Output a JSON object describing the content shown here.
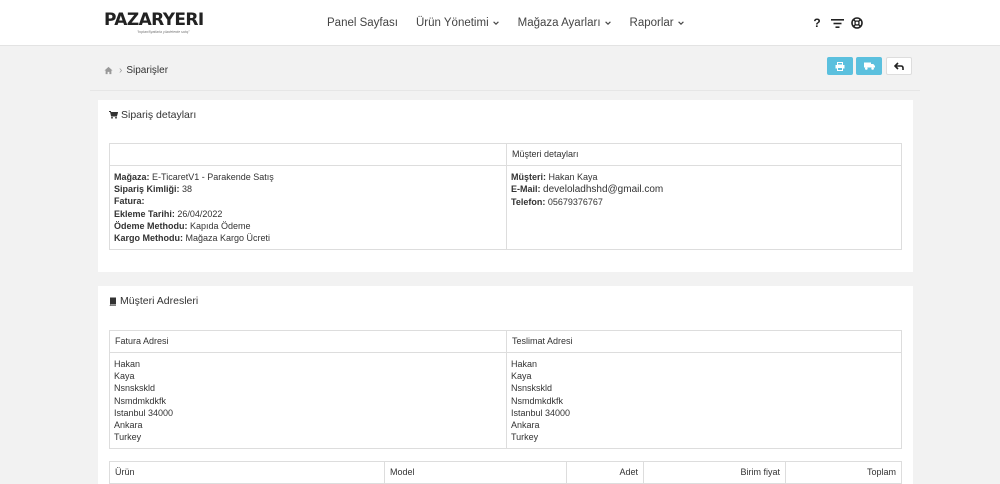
{
  "header": {
    "logo_text": "PAZARYERI",
    "logo_tagline": "\"toptan/fiyatlarla yüzdelerde satış\"",
    "nav": [
      {
        "label": "Panel Sayfası",
        "has_dropdown": false
      },
      {
        "label": "Ürün Yönetimi",
        "has_dropdown": true
      },
      {
        "label": "Mağaza Ayarları",
        "has_dropdown": true
      },
      {
        "label": "Raporlar",
        "has_dropdown": true
      }
    ],
    "icons": [
      "question-icon",
      "filter-icon",
      "support-icon"
    ],
    "question_glyph": "?"
  },
  "breadcrumb": {
    "current": "Siparişler"
  },
  "actions": [
    {
      "icon": "print-icon",
      "color": "#5bc0de"
    },
    {
      "icon": "truck-icon",
      "color": "#5bc0de"
    },
    {
      "icon": "back-icon",
      "color": "#ffffff"
    }
  ],
  "order_panel": {
    "title": "Sipariş detayları",
    "customer_header": "Müşteri detayları",
    "store_fields": [
      {
        "label": "Mağaza:",
        "value": "E-TicaretV1 - Parakende Satış"
      },
      {
        "label": "Sipariş Kimliği:",
        "value": "38"
      },
      {
        "label": "Fatura:",
        "value": ""
      },
      {
        "label": "Ekleme Tarihi:",
        "value": "26/04/2022"
      },
      {
        "label": "Ödeme Methodu:",
        "value": "Kapıda Ödeme"
      },
      {
        "label": "Kargo Methodu:",
        "value": "Mağaza Kargo Ücreti"
      }
    ],
    "customer_fields": [
      {
        "label": "Müşteri:",
        "value": "Hakan Kaya"
      },
      {
        "label": "E-Mail:",
        "value": "develoladhshd@gmail.com"
      },
      {
        "label": "Telefon:",
        "value": "05679376767"
      }
    ]
  },
  "address_panel": {
    "title": "Müşteri Adresleri",
    "billing_header": "Fatura Adresi",
    "shipping_header": "Teslimat Adresi",
    "billing_lines": [
      "Hakan",
      "Kaya",
      "Nsnskskld",
      "Nsmdmkdkfk",
      "Istanbul 34000",
      "Ankara",
      "Turkey"
    ],
    "shipping_lines": [
      "Hakan",
      "Kaya",
      "Nsnskskld",
      "Nsmdmkdkfk",
      "Istanbul 34000",
      "Ankara",
      "Turkey"
    ]
  },
  "products_table": {
    "columns": [
      "Ürün",
      "Model",
      "Adet",
      "Birim fiyat",
      "Toplam"
    ]
  },
  "colors": {
    "accent": "#5bc0de",
    "background": "#f2f2f2"
  }
}
